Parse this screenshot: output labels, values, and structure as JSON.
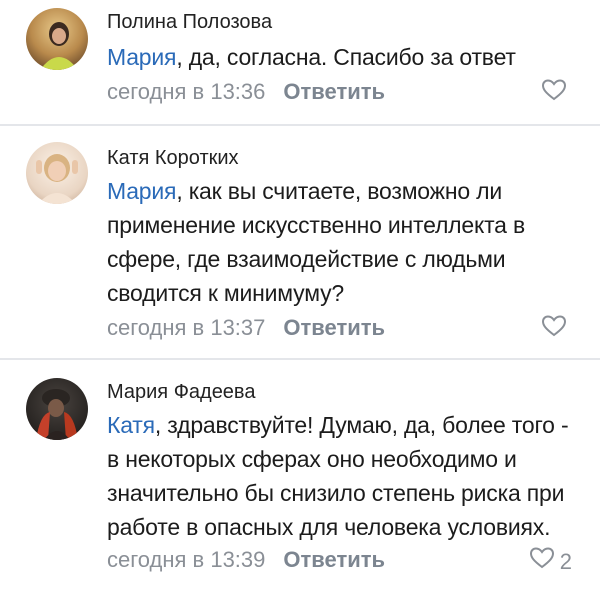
{
  "comments": [
    {
      "author": "Полина Полозова",
      "mention": "Мария",
      "text": ", да, согласна. Спасибо за ответ",
      "time": "сегодня в 13:36",
      "reply_label": "Ответить",
      "likes": "",
      "avatar_icon": "avatar-photo"
    },
    {
      "author": "Катя Коротких",
      "mention": "Мария",
      "text": ", как вы считаете, возможно ли применение искусственно интеллекта в сфере, где взаимодействие с людьми сводится к минимуму?",
      "time": "сегодня в 13:37",
      "reply_label": "Ответить",
      "likes": "",
      "avatar_icon": "avatar-photo"
    },
    {
      "author": "Мария Фадеева",
      "mention": "Катя",
      "text": ", здравствуйте! Думаю, да, более того - в некоторых сферах оно необходимо и значительно бы снизило степень риска при работе в опасных для человека условиях.",
      "time": "сегодня в 13:39",
      "reply_label": "Ответить",
      "likes": "2",
      "avatar_icon": "avatar-photo"
    }
  ],
  "colors": {
    "mention": "#2a6ab8",
    "meta": "#8a8f96",
    "divider": "#e4e6ea"
  },
  "icons": {
    "like": "heart-outline-icon"
  }
}
